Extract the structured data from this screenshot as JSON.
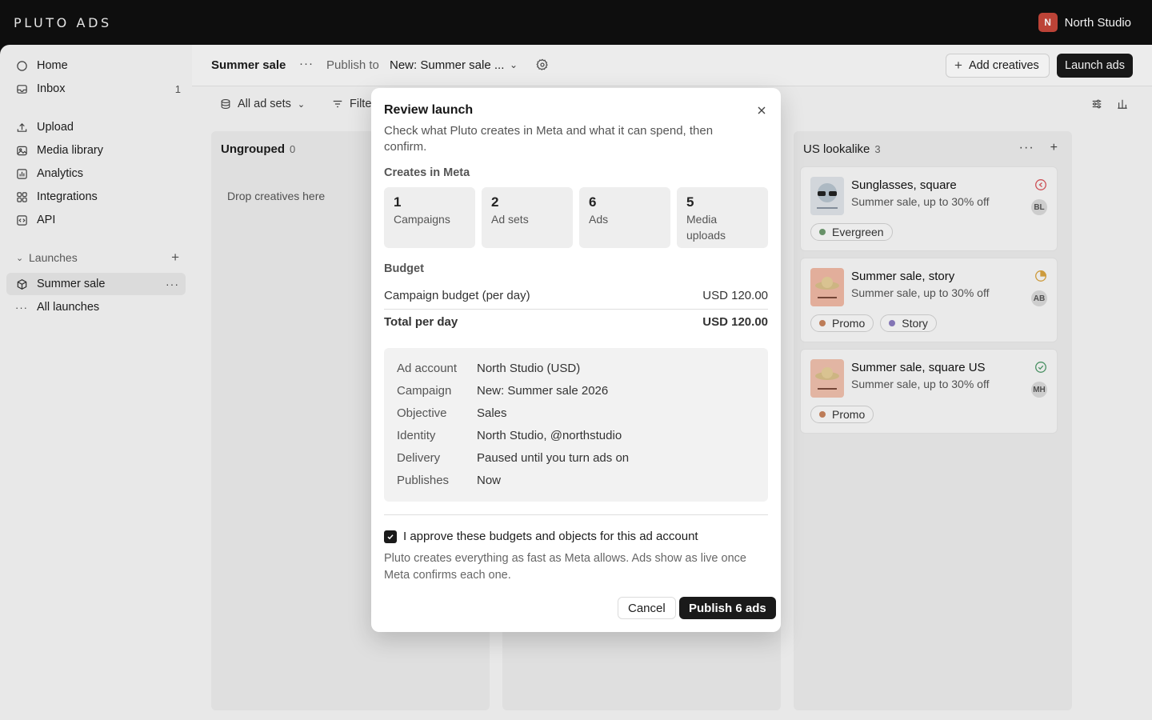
{
  "app": {
    "logo": "PLUTO ADS",
    "org_initial": "N",
    "org_name": "North Studio"
  },
  "sidebar": {
    "items": [
      {
        "label": "Home",
        "icon": "home-icon"
      },
      {
        "label": "Inbox",
        "icon": "inbox-icon",
        "count": "1"
      },
      {
        "label": "Upload",
        "icon": "upload-icon"
      },
      {
        "label": "Media library",
        "icon": "image-icon"
      },
      {
        "label": "Analytics",
        "icon": "bar-chart-icon"
      },
      {
        "label": "Integrations",
        "icon": "grid-icon"
      },
      {
        "label": "API",
        "icon": "code-icon"
      }
    ],
    "launches_label": "Launches",
    "launches": [
      {
        "label": "Summer sale",
        "icon": "box-icon",
        "active": true
      },
      {
        "label": "All launches",
        "icon": "dots-icon"
      }
    ]
  },
  "header": {
    "title": "Summer sale",
    "publish_to_label": "Publish to",
    "publish_target": "New: Summer sale ...",
    "add_creatives": "Add creatives",
    "launch_ads": "Launch ads"
  },
  "toolbar": {
    "adsets_filter": "All ad sets",
    "filter": "Filte"
  },
  "columns": [
    {
      "title": "Ungrouped",
      "count": "0",
      "drop_text": "Drop creatives here"
    },
    {
      "title": "US lookalike",
      "count": "3",
      "cards": [
        {
          "title": "Sunglasses, square",
          "subtitle": "Summer sale, up to 30% off",
          "status": "error-icon",
          "initials": "BL",
          "tags": [
            {
              "label": "Evergreen",
              "color": "#6d9a6f"
            }
          ]
        },
        {
          "title": "Summer sale, story",
          "subtitle": "Summer sale, up to 30% off",
          "status": "in-progress-icon",
          "initials": "AB",
          "tags": [
            {
              "label": "Promo",
              "color": "#c8845e"
            },
            {
              "label": "Story",
              "color": "#8b7cc0"
            }
          ]
        },
        {
          "title": "Summer sale, square US",
          "subtitle": "Summer sale, up to 30% off",
          "status": "success-icon",
          "initials": "MH",
          "tags": [
            {
              "label": "Promo",
              "color": "#c8845e"
            }
          ]
        }
      ]
    }
  ],
  "modal": {
    "title": "Review launch",
    "description": "Check what Pluto creates in Meta and what it can spend, then confirm.",
    "creates_heading": "Creates in Meta",
    "stats": [
      {
        "value": "1",
        "label": "Campaigns"
      },
      {
        "value": "2",
        "label": "Ad sets"
      },
      {
        "value": "6",
        "label": "Ads"
      },
      {
        "value": "5",
        "label": "Media uploads"
      }
    ],
    "budget_heading": "Budget",
    "budget_rows": [
      {
        "label": "Campaign budget (per day)",
        "value": "USD 120.00"
      },
      {
        "label": "Total per day",
        "value": "USD 120.00"
      }
    ],
    "details": [
      {
        "key": "Ad account",
        "value": "North Studio (USD)"
      },
      {
        "key": "Campaign",
        "value": "New: Summer sale 2026"
      },
      {
        "key": "Objective",
        "value": "Sales"
      },
      {
        "key": "Identity",
        "value": "North Studio, @northstudio"
      },
      {
        "key": "Delivery",
        "value": "Paused until you turn ads on"
      },
      {
        "key": "Publishes",
        "value": "Now"
      }
    ],
    "approve_label": "I approve these budgets and objects for this ad account",
    "approve_checked": true,
    "note": "Pluto creates everything as fast as Meta allows. Ads show as live once Meta confirms each one.",
    "cancel": "Cancel",
    "publish": "Publish 6 ads"
  }
}
